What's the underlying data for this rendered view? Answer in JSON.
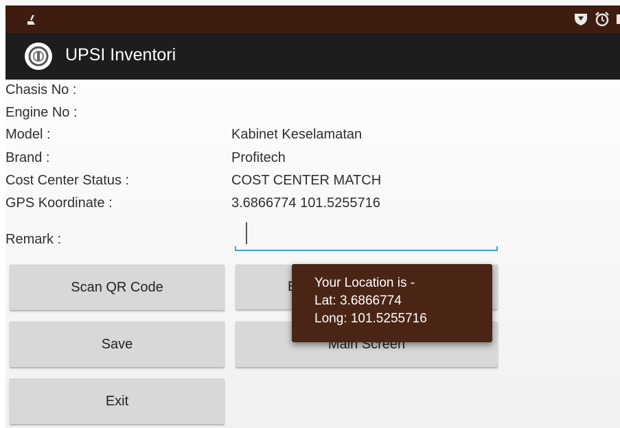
{
  "app": {
    "title": "UPSI Inventori"
  },
  "status_bar": {
    "icons": [
      "cleaning-broom-icon",
      "shield-icon",
      "alarm-clock-icon"
    ]
  },
  "form": {
    "chasis_label": "Chasis No :",
    "chasis_value": "",
    "engine_label": "Engine No :",
    "engine_value": "",
    "model_label": "Model :",
    "model_value": "Kabinet Keselamatan",
    "brand_label": "Brand :",
    "brand_value": "Profitech",
    "cost_center_label": "Cost Center Status :",
    "cost_center_value": "COST CENTER MATCH",
    "gps_label": "GPS Koordinate :",
    "gps_value": "3.6866774  101.5255716",
    "remark_label": "Remark :",
    "remark_value": ""
  },
  "buttons": {
    "scan_qr": "Scan QR Code",
    "save": "Save",
    "exit": "Exit",
    "right_top_partial": "E",
    "main_screen": "Main Screen"
  },
  "toast": {
    "line1": "Your Location is -",
    "line2": "Lat: 3.6866774",
    "line3": "Long: 101.5255716"
  },
  "colors": {
    "status_bar": "#3e1d10",
    "action_bar": "#1d1d1d",
    "input_accent": "#35a6d3",
    "toast_bg": "#4a2516"
  }
}
